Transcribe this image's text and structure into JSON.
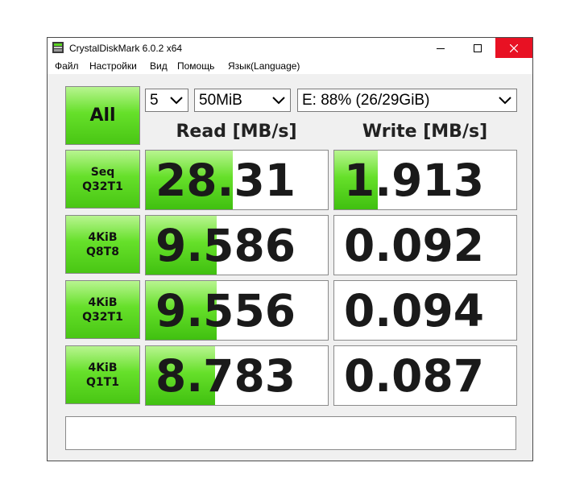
{
  "window": {
    "title": "CrystalDiskMark 6.0.2 x64"
  },
  "menu": [
    "Файл",
    "Настройки",
    "Вид",
    "Помощь",
    "Язык(Language)"
  ],
  "controls": {
    "all_label": "All",
    "count": "5",
    "size": "50MiB",
    "drive": "E: 88% (26/29GiB)"
  },
  "headers": {
    "read": "Read [MB/s]",
    "write": "Write [MB/s]"
  },
  "tests": [
    {
      "label": "Seq\nQ32T1",
      "read": "28.31",
      "write": "1.913",
      "read_fill": 0.48,
      "write_fill": 0.24
    },
    {
      "label": "4KiB\nQ8T8",
      "read": "9.586",
      "write": "0.092",
      "read_fill": 0.39,
      "write_fill": 0.0
    },
    {
      "label": "4KiB\nQ32T1",
      "read": "9.556",
      "write": "0.094",
      "read_fill": 0.39,
      "write_fill": 0.0
    },
    {
      "label": "4KiB\nQ1T1",
      "read": "8.783",
      "write": "0.087",
      "read_fill": 0.38,
      "write_fill": 0.0
    }
  ],
  "comment": ""
}
